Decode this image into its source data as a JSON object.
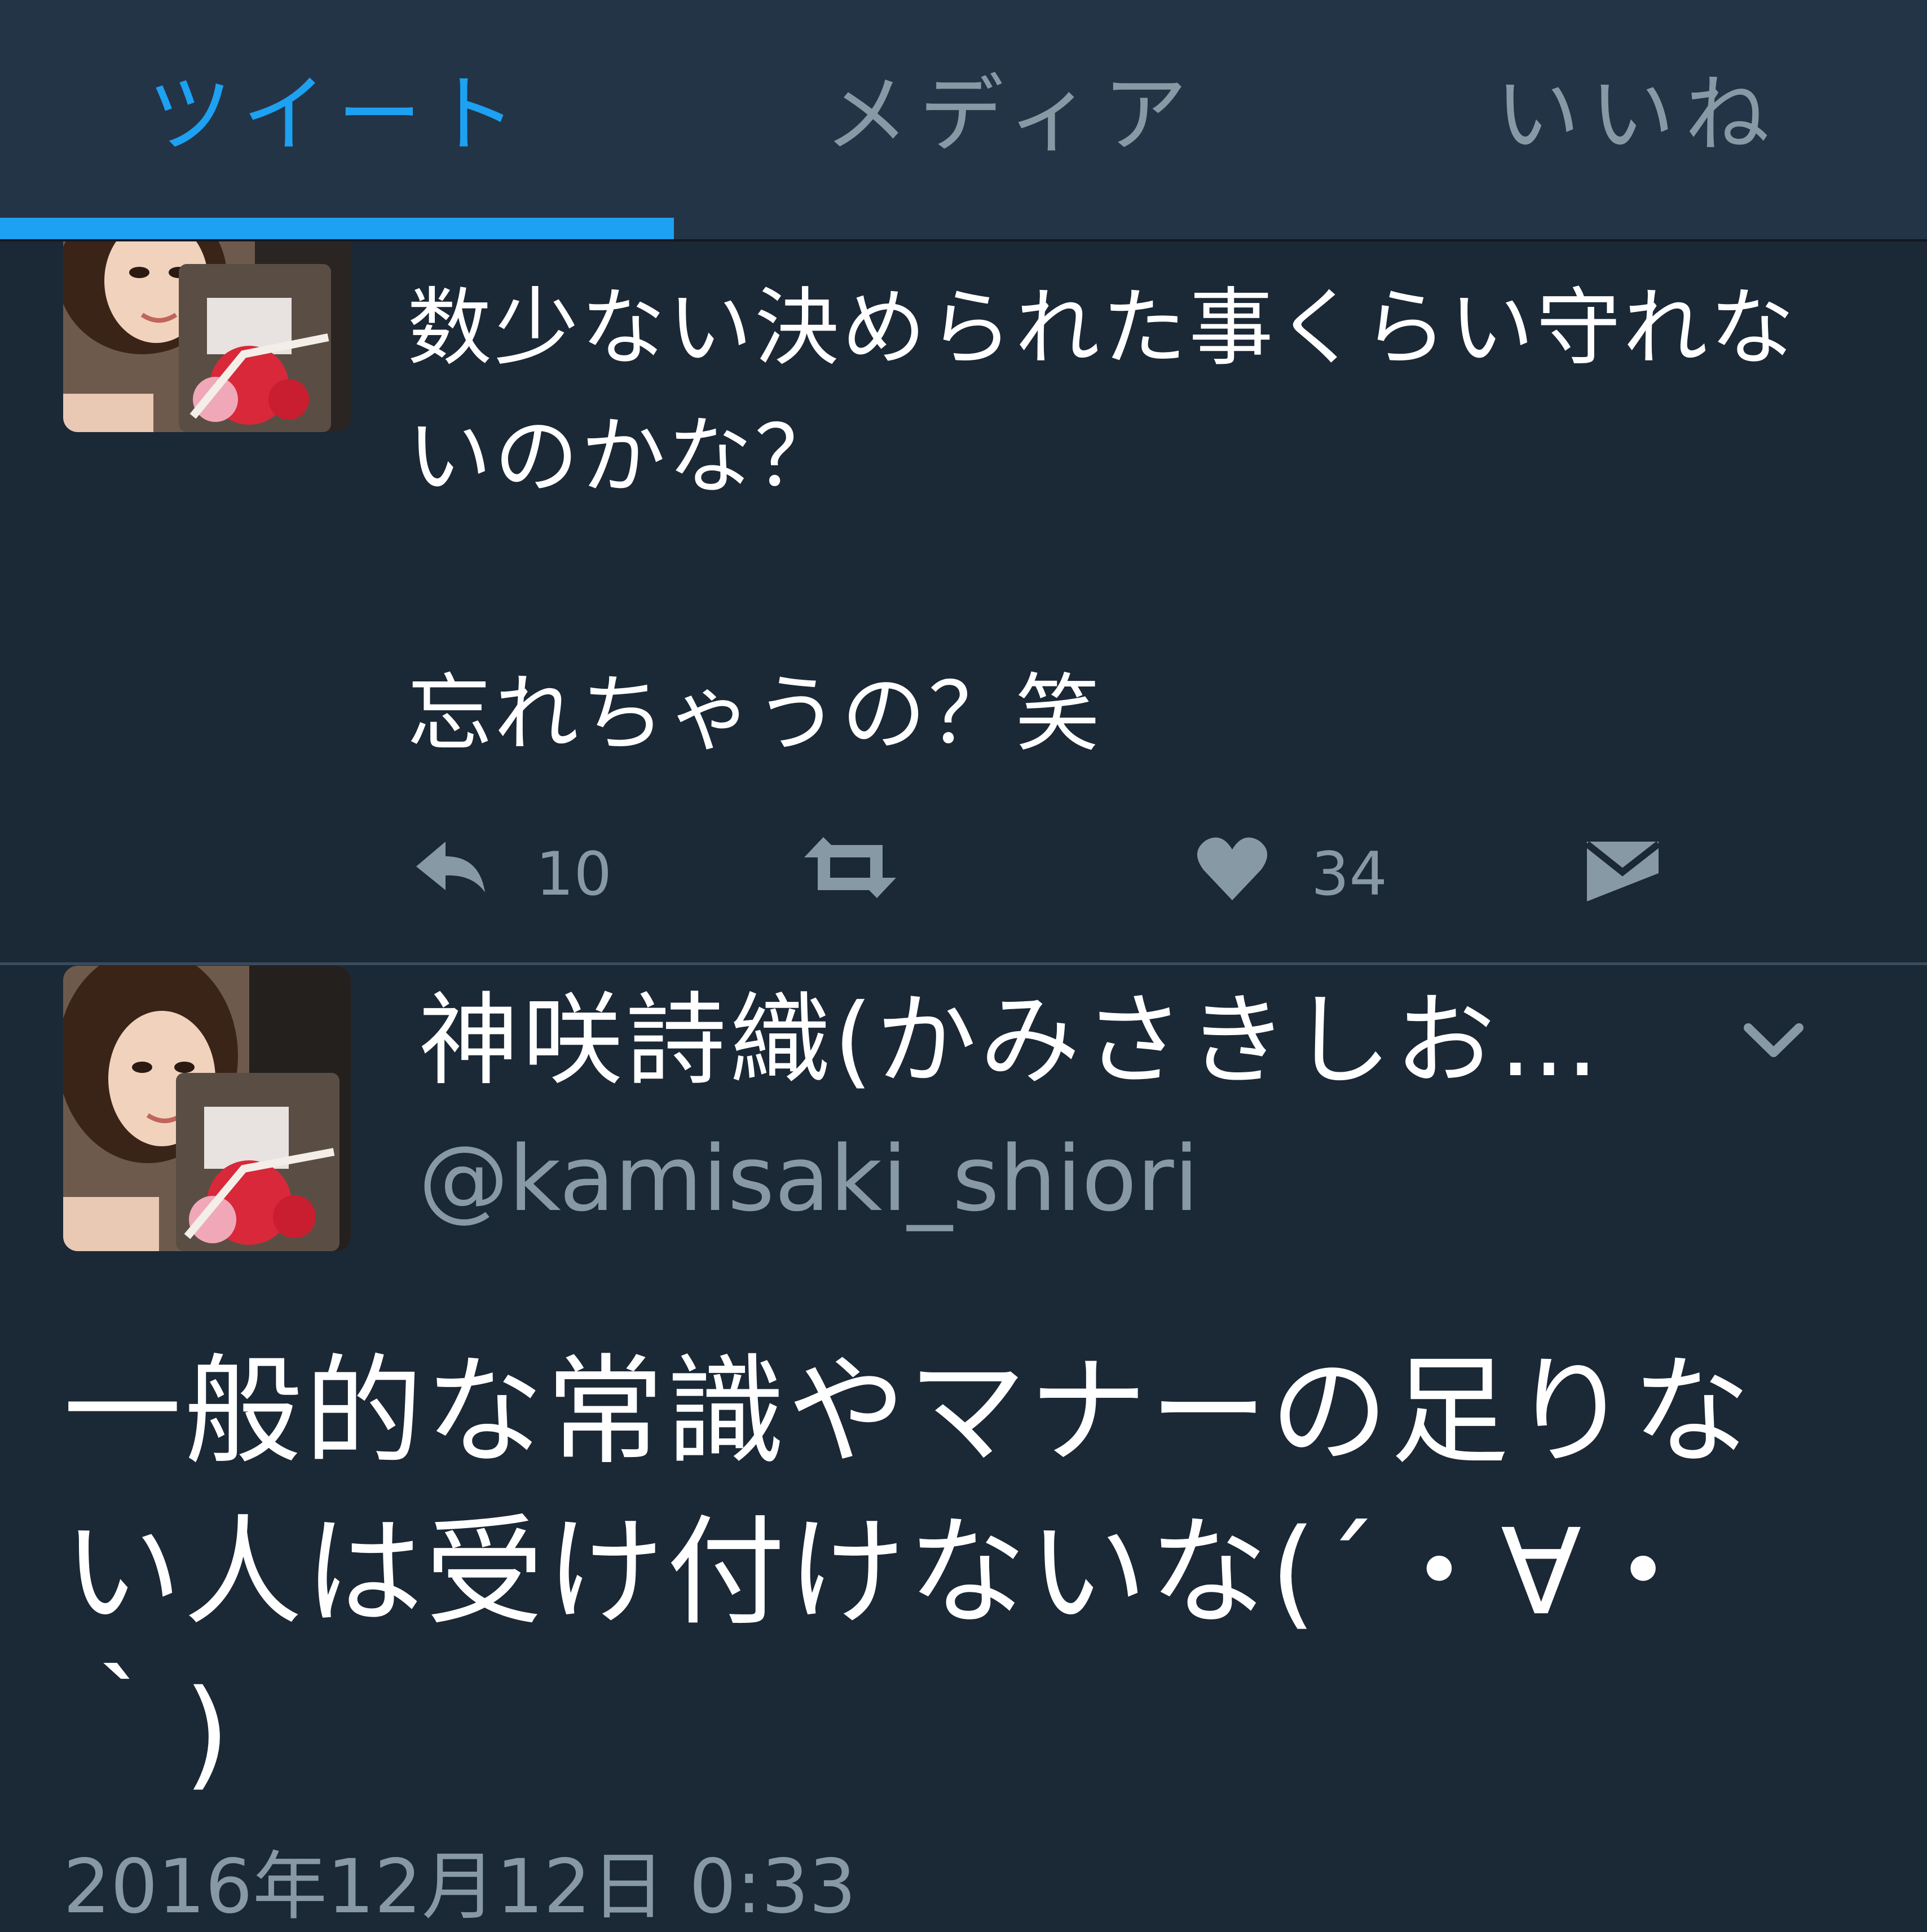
{
  "tabs": [
    {
      "label": "ツイート",
      "active": true
    },
    {
      "label": "メディア",
      "active": false
    },
    {
      "label": "いいね",
      "active": false
    }
  ],
  "tweet1": {
    "text": "数少ない決められた事くらい守れないのかな？\n\n忘れちゃうの？笑",
    "actions": {
      "reply_count": "10",
      "like_count": "34"
    }
  },
  "tweet2": {
    "display_name": "神咲詩織(かみさきしお…",
    "handle": "@kamisaki_shiori",
    "text": "一般的な常識やマナーの足りない人は受け付けないな(´・∀・｀)",
    "timestamp": "2016年12月12日 0:33"
  },
  "colors": {
    "background": "#1b2836",
    "tab_bar": "#243447",
    "accent": "#1da1f2",
    "secondary_text": "#8899a6",
    "primary_text": "#ffffff"
  },
  "icons": [
    "reply-icon",
    "retweet-icon",
    "heart-icon",
    "direct-message-icon",
    "chevron-down-icon"
  ]
}
